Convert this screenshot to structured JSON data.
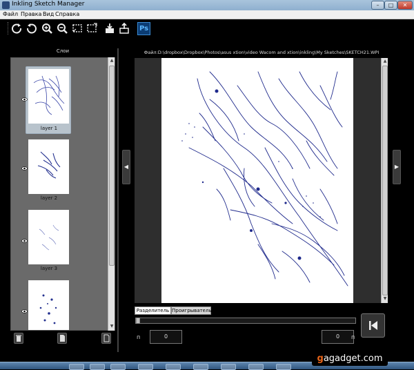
{
  "window": {
    "title": "Inkling Sketch Manager",
    "min_glyph": "–",
    "max_glyph": "□",
    "close_glyph": "✕"
  },
  "menu": {
    "items": [
      "Файл",
      "Правка",
      "Вид",
      "Справка"
    ]
  },
  "toolbar": {
    "icons": [
      "rotate-cw-icon",
      "rotate-ccw-icon",
      "zoom-in-icon",
      "zoom-out-icon",
      "crop-icon",
      "fit-icon",
      "import-icon",
      "export-icon"
    ],
    "ps_label": "Ps"
  },
  "layers": {
    "title": "Слои",
    "items": [
      {
        "label": "layer 1",
        "selected": true
      },
      {
        "label": "layer 2",
        "selected": false
      },
      {
        "label": "layer 3",
        "selected": false
      },
      {
        "label": "",
        "selected": false
      }
    ]
  },
  "canvas": {
    "file_path": "Файл:D:\\dropbox\\Dropbox\\Photos\\asus xtion\\video Wacom and xtion\\inkling\\My Sketches\\SKETCH21.WPI",
    "stroke_color": "#1f2a8c"
  },
  "bottom": {
    "tabs": [
      "Разделитель",
      "Проигрыватель"
    ],
    "left_label": "п",
    "right_label": "п",
    "left_value": "0",
    "right_value": "0",
    "timeline_position": 0
  },
  "watermark": {
    "prefix": "g",
    "middle": "a",
    "suffix": "gadget.com"
  }
}
